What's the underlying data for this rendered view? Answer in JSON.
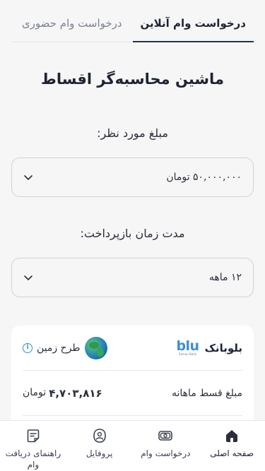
{
  "tabs": [
    {
      "label": "درخواست وام آنلاین",
      "active": true
    },
    {
      "label": "درخواست وام حضوری",
      "active": false
    }
  ],
  "title": "ماشین محاسبه‌گر اقساط",
  "amount": {
    "label": "مبلغ مورد نظر:",
    "value": "۵۰,۰۰۰,۰۰۰ تومان"
  },
  "duration": {
    "label": "مدت زمان بازپرداخت:",
    "value": "۱۲ ماهه"
  },
  "card": {
    "bank_name": "بلوبانک",
    "logo_text": "blu",
    "logo_sub": "Saman Bank",
    "plan_name": "طرح زمین",
    "installment_label": "مبلغ قسط ماهانه",
    "installment_value": "۴,۷۰۳,۸۱۶",
    "installment_unit": "تومان"
  },
  "bottom_nav": [
    {
      "label": "صفحه اصلی",
      "icon": "home-icon",
      "active": true
    },
    {
      "label": "درخواست وام",
      "icon": "money-icon",
      "active": false
    },
    {
      "label": "پروفایل",
      "icon": "profile-icon",
      "active": false
    },
    {
      "label": "راهنمای دریافت وام",
      "icon": "guide-icon",
      "active": false
    }
  ],
  "colors": {
    "accent": "#27324a",
    "logo_blue": "#3a8fd6",
    "info_blue": "#2f8fd9"
  }
}
